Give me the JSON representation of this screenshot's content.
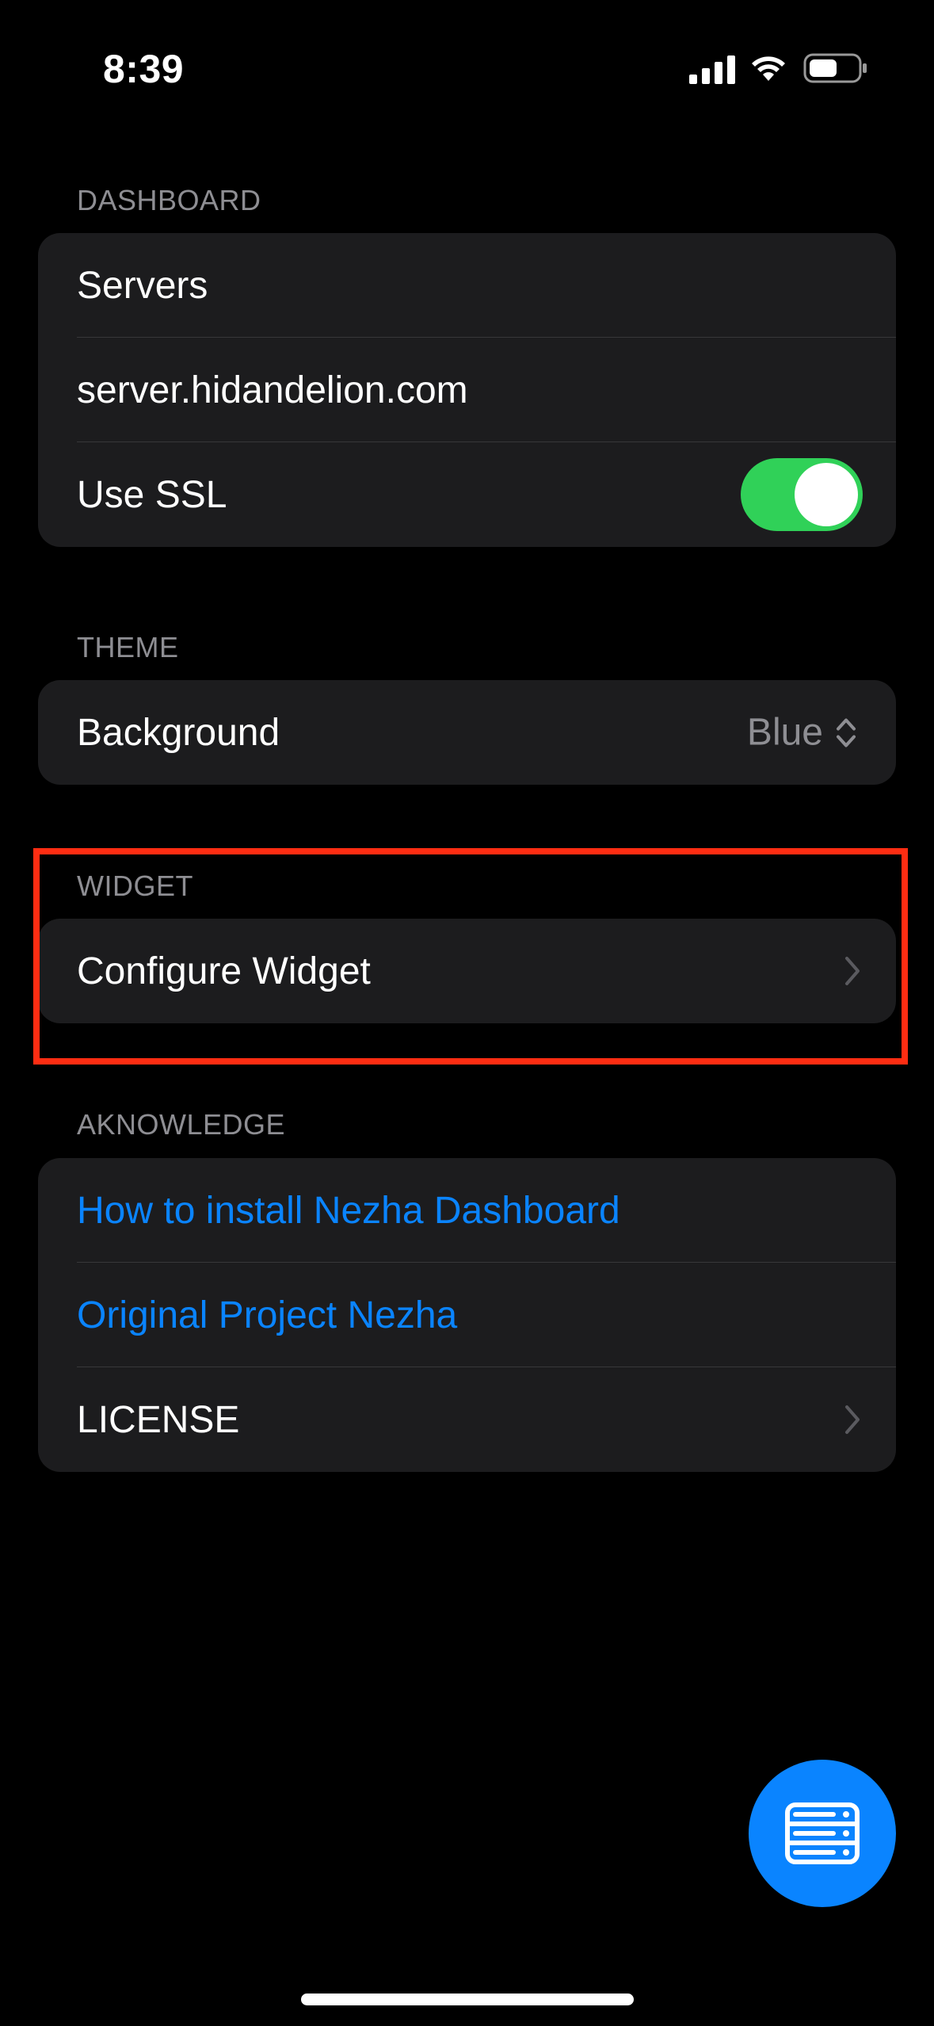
{
  "status_bar": {
    "time": "8:39",
    "icons": [
      "cellular-signal-icon",
      "wifi-icon",
      "battery-icon"
    ]
  },
  "sections": {
    "dashboard": {
      "header": "DASHBOARD",
      "rows": {
        "servers": "Servers",
        "host": "server.hidandelion.com",
        "ssl": {
          "label": "Use SSL",
          "enabled": true
        }
      }
    },
    "theme": {
      "header": "THEME",
      "background": {
        "label": "Background",
        "value": "Blue"
      }
    },
    "widget": {
      "header": "WIDGET",
      "configure": "Configure Widget"
    },
    "acknowledge": {
      "header": "AKNOWLEDGE",
      "rows": {
        "install": "How to install Nezha Dashboard",
        "original": "Original Project Nezha",
        "license": "LICENSE"
      }
    }
  },
  "fab": {
    "icon": "server-list-icon"
  },
  "colors": {
    "background": "#000000",
    "card": "#1c1c1e",
    "accent": "#0a84ff",
    "toggle_on": "#30d158",
    "highlight": "#ff2d12",
    "secondary_text": "#8e8e93"
  }
}
